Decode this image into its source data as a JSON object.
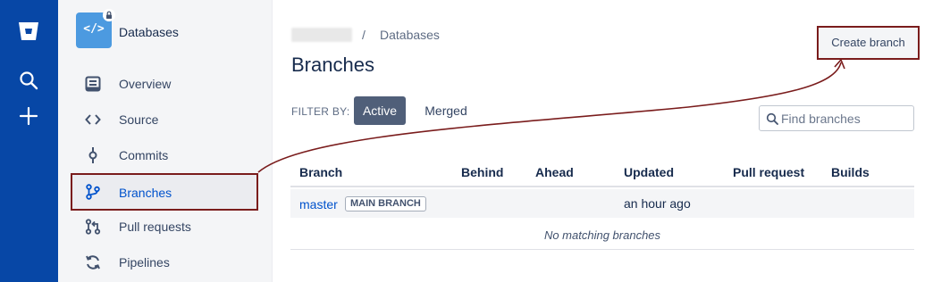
{
  "sidebar": {
    "repo_name": "Databases",
    "items": [
      {
        "label": "Overview"
      },
      {
        "label": "Source"
      },
      {
        "label": "Commits"
      },
      {
        "label": "Branches"
      },
      {
        "label": "Pull requests"
      },
      {
        "label": "Pipelines"
      }
    ]
  },
  "breadcrumb": {
    "separator": "/",
    "current": "Databases"
  },
  "page": {
    "title": "Branches",
    "create_button": "Create branch"
  },
  "filter": {
    "label": "FILTER BY:",
    "active": "Active",
    "merged": "Merged"
  },
  "search": {
    "placeholder": "Find branches"
  },
  "table": {
    "columns": [
      "Branch",
      "Behind",
      "Ahead",
      "Updated",
      "Pull request",
      "Builds"
    ],
    "rows": [
      {
        "branch": "master",
        "badge": "MAIN BRANCH",
        "updated": "an hour ago"
      }
    ],
    "empty_message": "No matching branches"
  },
  "colors": {
    "global_nav": "#0747a6",
    "highlight_border": "#7a1c1c",
    "link": "#0052cc"
  },
  "icons": [
    "bitbucket-logo-icon",
    "search-icon",
    "plus-icon",
    "code-icon",
    "lock-icon",
    "overview-icon",
    "source-icon",
    "commits-icon",
    "branches-icon",
    "pull-requests-icon",
    "pipelines-icon"
  ]
}
